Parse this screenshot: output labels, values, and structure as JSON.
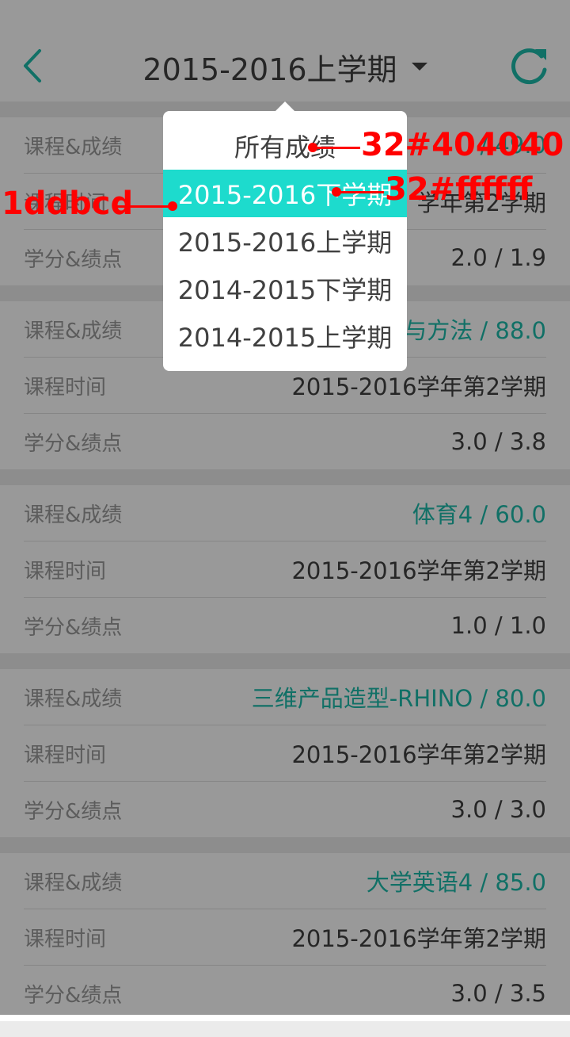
{
  "header": {
    "title": "2015-2016上学期",
    "icons": {
      "back": "chevron-left-icon",
      "dropdown": "caret-down-icon",
      "refresh": "refresh-icon"
    }
  },
  "colors": {
    "accent": "#1dbbab",
    "selected_bg": "#1ddbcd",
    "text": "#404040",
    "label": "#9a9a9a"
  },
  "cards": [
    {
      "rows": [
        {
          "label": "课程&成绩",
          "value": "/ 49.0",
          "accent": true
        },
        {
          "label": "课程时间",
          "value": "学年第2学期",
          "accent": false
        },
        {
          "label": "学分&绩点",
          "value": "2.0 / 1.9",
          "accent": false
        }
      ]
    },
    {
      "rows": [
        {
          "label": "课程&成绩",
          "value": "与方法 / 88.0",
          "accent": true
        },
        {
          "label": "课程时间",
          "value": "2015-2016学年第2学期",
          "accent": false
        },
        {
          "label": "学分&绩点",
          "value": "3.0 / 3.8",
          "accent": false
        }
      ]
    },
    {
      "rows": [
        {
          "label": "课程&成绩",
          "value": "体育4 / 60.0",
          "accent": true
        },
        {
          "label": "课程时间",
          "value": "2015-2016学年第2学期",
          "accent": false
        },
        {
          "label": "学分&绩点",
          "value": "1.0 / 1.0",
          "accent": false
        }
      ]
    },
    {
      "rows": [
        {
          "label": "课程&成绩",
          "value": "三维产品造型-RHINO / 80.0",
          "accent": true
        },
        {
          "label": "课程时间",
          "value": "2015-2016学年第2学期",
          "accent": false
        },
        {
          "label": "学分&绩点",
          "value": "3.0 / 3.0",
          "accent": false
        }
      ]
    },
    {
      "rows": [
        {
          "label": "课程&成绩",
          "value": "大学英语4 / 85.0",
          "accent": true
        },
        {
          "label": "课程时间",
          "value": "2015-2016学年第2学期",
          "accent": false
        },
        {
          "label": "学分&绩点",
          "value": "3.0 / 3.5",
          "accent": false
        }
      ]
    }
  ],
  "dropdown": {
    "items": [
      "所有成绩",
      "2015-2016下学期",
      "2015-2016上学期",
      "2014-2015下学期",
      "2014-2015上学期"
    ],
    "selected_index": 1
  },
  "annotations": {
    "text_spec": "32#404040",
    "selected_text_spec": "32#ffffff",
    "selected_bg_spec": "1ddbcd"
  }
}
